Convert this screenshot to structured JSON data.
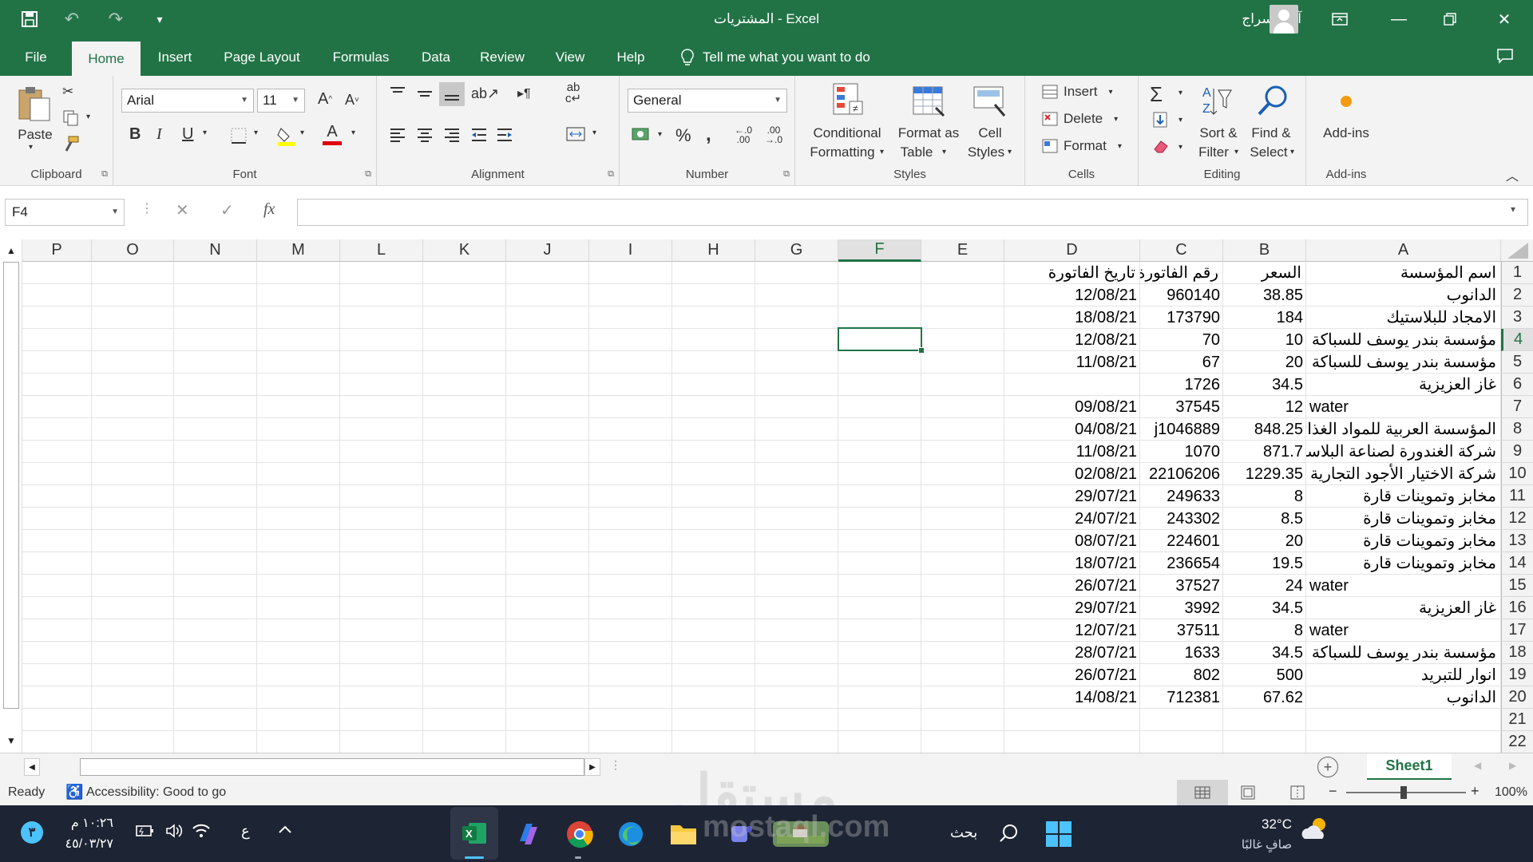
{
  "titlebar": {
    "title": "المشتريات  -  Excel",
    "user": "آيات سراج"
  },
  "tabs": [
    "File",
    "Home",
    "Insert",
    "Page Layout",
    "Formulas",
    "Data",
    "Review",
    "View",
    "Help"
  ],
  "tell_me": "Tell me what you want to do",
  "ribbon": {
    "clipboard": {
      "label": "Clipboard",
      "paste": "Paste"
    },
    "font": {
      "label": "Font",
      "name": "Arial",
      "size": "11"
    },
    "alignment": {
      "label": "Alignment"
    },
    "number": {
      "label": "Number",
      "format": "General"
    },
    "styles": {
      "label": "Styles",
      "conditional1": "Conditional",
      "conditional2": "Formatting",
      "format_as1": "Format as",
      "format_as2": "Table",
      "cell1": "Cell",
      "cell2": "Styles"
    },
    "cells": {
      "label": "Cells",
      "insert": "Insert",
      "delete": "Delete",
      "format": "Format"
    },
    "editing": {
      "label": "Editing",
      "sort1": "Sort &",
      "sort2": "Filter",
      "find1": "Find &",
      "find2": "Select"
    },
    "addins": {
      "label": "Add-ins",
      "button": "Add-ins"
    }
  },
  "formula_bar": {
    "name_box": "F4",
    "fx": "fx",
    "content": ""
  },
  "grid": {
    "columns": [
      "P",
      "O",
      "N",
      "M",
      "L",
      "K",
      "J",
      "I",
      "H",
      "G",
      "F",
      "E",
      "D",
      "C",
      "B",
      "A"
    ],
    "selected_column": "F",
    "selected_row": 4,
    "rows": [
      {
        "n": 1,
        "A": "اسم المؤسسة",
        "B": "السعر",
        "C": "رقم الفاتورة",
        "D": "تاريخ الفاتورة"
      },
      {
        "n": 2,
        "A": "الدانوب",
        "B": "38.85",
        "C": "960140",
        "D": "12/08/21"
      },
      {
        "n": 3,
        "A": "الامجاد للبلاستيك",
        "B": "184",
        "C": "173790",
        "D": "18/08/21"
      },
      {
        "n": 4,
        "A": "مؤسسة بندر يوسف للسباكة",
        "B": "10",
        "C": "70",
        "D": "12/08/21"
      },
      {
        "n": 5,
        "A": "مؤسسة بندر يوسف للسباكة",
        "B": "20",
        "C": "67",
        "D": "11/08/21"
      },
      {
        "n": 6,
        "A": "غاز العزيزية",
        "B": "34.5",
        "C": "1726",
        "D": ""
      },
      {
        "n": 7,
        "A": "water",
        "B": "12",
        "C": "37545",
        "D": "09/08/21"
      },
      {
        "n": 8,
        "A": "المؤسسة العربية للمواد الغذائيه",
        "B": "848.25",
        "C": "j1046889",
        "D": "04/08/21"
      },
      {
        "n": 9,
        "A": "شركة الغندورة لصناعة البلاستك",
        "B": "871.7",
        "C": "1070",
        "D": "11/08/21"
      },
      {
        "n": 10,
        "A": "شركة الاختيار الأجود التجارية",
        "B": "1229.35",
        "C": "22106206",
        "D": "02/08/21"
      },
      {
        "n": 11,
        "A": "مخابز وتموينات قارة",
        "B": "8",
        "C": "249633",
        "D": "29/07/21"
      },
      {
        "n": 12,
        "A": "مخابز وتموينات قارة",
        "B": "8.5",
        "C": "243302",
        "D": "24/07/21"
      },
      {
        "n": 13,
        "A": "مخابز وتموينات قارة",
        "B": "20",
        "C": "224601",
        "D": "08/07/21"
      },
      {
        "n": 14,
        "A": "مخابز وتموينات قارة",
        "B": "19.5",
        "C": "236654",
        "D": "18/07/21"
      },
      {
        "n": 15,
        "A": "water",
        "B": "24",
        "C": "37527",
        "D": "26/07/21"
      },
      {
        "n": 16,
        "A": "غاز العزيزية",
        "B": "34.5",
        "C": "3992",
        "D": "29/07/21"
      },
      {
        "n": 17,
        "A": "water",
        "B": "8",
        "C": "37511",
        "D": "12/07/21"
      },
      {
        "n": 18,
        "A": "مؤسسة بندر يوسف للسباكة",
        "B": "34.5",
        "C": "1633",
        "D": "28/07/21"
      },
      {
        "n": 19,
        "A": "انوار للتبريد",
        "B": "500",
        "C": "802",
        "D": "26/07/21"
      },
      {
        "n": 20,
        "A": "الدانوب",
        "B": "67.62",
        "C": "712381",
        "D": "14/08/21"
      },
      {
        "n": 21,
        "A": "",
        "B": "",
        "C": "",
        "D": ""
      },
      {
        "n": 22,
        "A": "",
        "B": "",
        "C": "",
        "D": ""
      }
    ]
  },
  "sheet_tab": "Sheet1",
  "status": {
    "ready": "Ready",
    "accessibility": "Accessibility: Good to go",
    "zoom": "100%"
  },
  "taskbar": {
    "search": "بحث",
    "weather_temp": "32°C",
    "weather_desc": "صافٍ غالبًا",
    "time": "١٠:٢٦ م",
    "date": "٤٥/٠٣/٢٧",
    "lang": "ع",
    "notif": "٣"
  },
  "watermark": {
    "ar": "مستقل",
    "en": "mostaql.com"
  },
  "colors": {
    "excel_green": "#217346",
    "ribbon_bg": "#f3f3f3",
    "taskbar_bg": "#1d2433"
  }
}
